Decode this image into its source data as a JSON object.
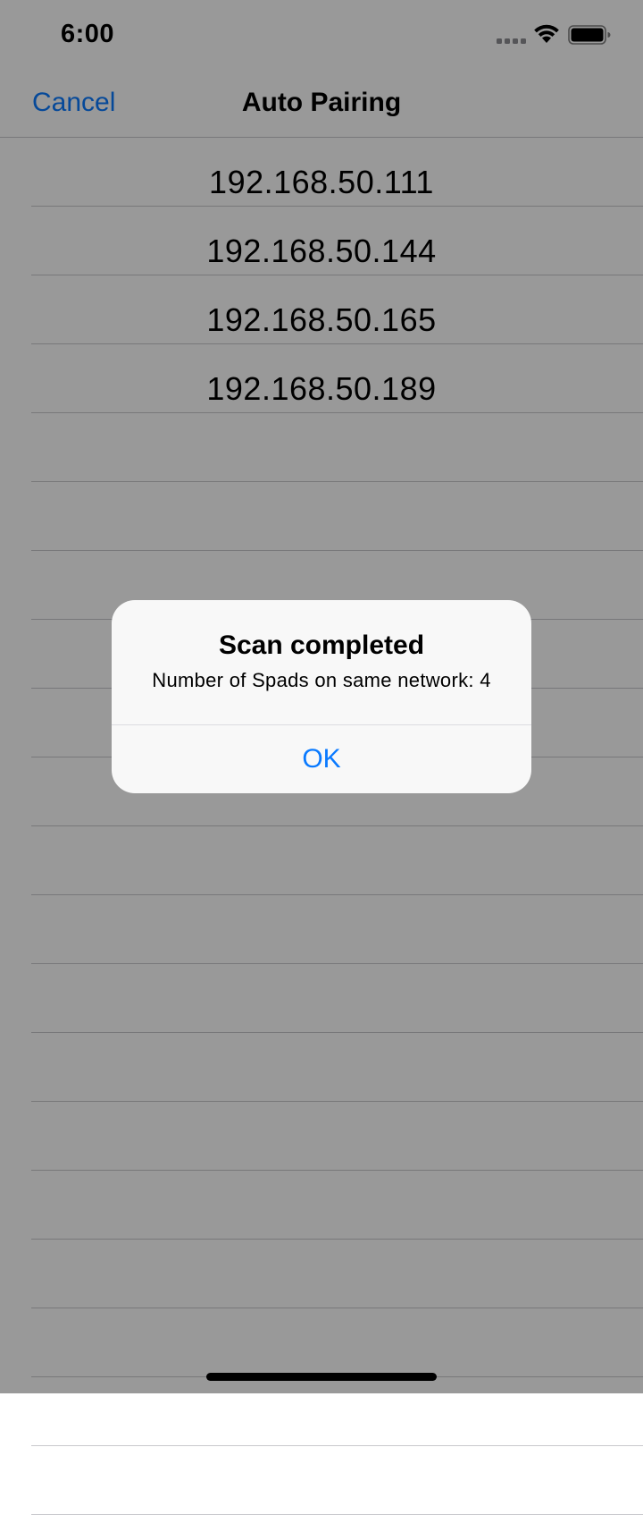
{
  "status_bar": {
    "time": "6:00",
    "icons": [
      "signal-icon",
      "wifi-icon",
      "battery-icon"
    ]
  },
  "nav": {
    "cancel_label": "Cancel",
    "title": "Auto Pairing"
  },
  "list": {
    "items": [
      {
        "label": "192.168.50.111"
      },
      {
        "label": "192.168.50.144"
      },
      {
        "label": "192.168.50.165"
      },
      {
        "label": "192.168.50.189"
      },
      {
        "label": ""
      },
      {
        "label": ""
      },
      {
        "label": ""
      },
      {
        "label": ""
      },
      {
        "label": ""
      },
      {
        "label": ""
      },
      {
        "label": ""
      },
      {
        "label": ""
      },
      {
        "label": ""
      },
      {
        "label": ""
      },
      {
        "label": ""
      },
      {
        "label": ""
      },
      {
        "label": ""
      },
      {
        "label": ""
      },
      {
        "label": ""
      },
      {
        "label": ""
      }
    ]
  },
  "alert": {
    "title": "Scan completed",
    "message": "Number of Spads on same network: 4",
    "ok_label": "OK"
  },
  "colors": {
    "accent": "#0a7aff",
    "separator": "#c8c8cc",
    "alert_background": "#f8f8f8",
    "dim_overlay": "rgba(0,0,0,0.4)"
  }
}
